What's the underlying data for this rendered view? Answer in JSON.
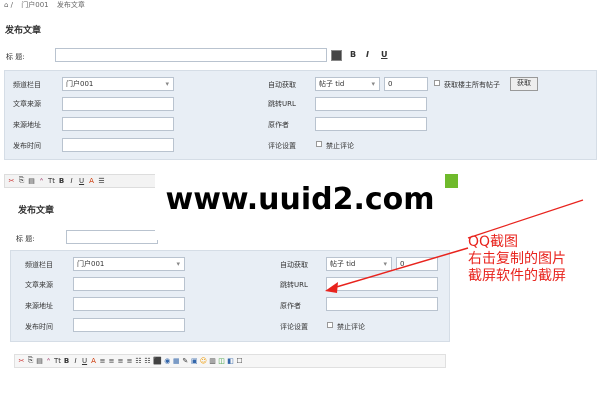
{
  "breadcrumb": [
    "门户001",
    "发布文章"
  ],
  "page1": {
    "title": "发布文章",
    "title_label": "标  题:",
    "format_buttons": [
      "B",
      "I",
      "U"
    ],
    "left_fields": [
      {
        "label": "频道栏目",
        "value": "门户001"
      },
      {
        "label": "文章来源",
        "value": ""
      },
      {
        "label": "来源地址",
        "value": ""
      },
      {
        "label": "发布时间",
        "value": ""
      }
    ],
    "right_fields": {
      "auto_fetch_label": "自动获取",
      "auto_fetch_select": "帖子 tid",
      "auto_fetch_value": "0",
      "fetch_all_label": "获取楼主所有帖子",
      "fetch_button": "获取",
      "redirect_label": "跳转URL",
      "author_label": "原作者",
      "comment_label": "评论设置",
      "disable_comment": "禁止评论"
    },
    "toolbar": [
      "✂",
      "⎘",
      "▤",
      "ᴬ",
      "Tt",
      "B",
      "I",
      "U",
      "A",
      "☰"
    ]
  },
  "page2": {
    "title": "发布文章",
    "title_label": "标  题:",
    "left_fields": [
      {
        "label": "频道栏目",
        "value": "门户001"
      },
      {
        "label": "文章来源",
        "value": ""
      },
      {
        "label": "来源地址",
        "value": ""
      },
      {
        "label": "发布时间",
        "value": ""
      }
    ],
    "right_fields": {
      "auto_fetch_label": "自动获取",
      "auto_fetch_select": "帖子 tid",
      "auto_fetch_value": "0",
      "redirect_label": "跳转URL",
      "author_label": "原作者",
      "comment_label": "评论设置",
      "disable_comment": "禁止评论"
    },
    "toolbar": [
      "✂",
      "⎘",
      "▤",
      "ᴬ",
      "Tt",
      "B",
      "I",
      "U",
      "A",
      "≡",
      "≡",
      "≡",
      "≡",
      "☷",
      "☷",
      "⬛",
      "◉",
      "▦",
      "✎",
      "▣",
      "☺",
      "▥",
      "◫",
      "◧",
      "☐"
    ]
  },
  "watermark": "www.uuid2.com",
  "annotation": [
    "QQ截图",
    "右击复制的图片",
    "截屏软件的截屏"
  ],
  "colors": {
    "annotation": "#e8231d",
    "panel": "#e8eef5",
    "accent_bar": "#6fba2c"
  }
}
